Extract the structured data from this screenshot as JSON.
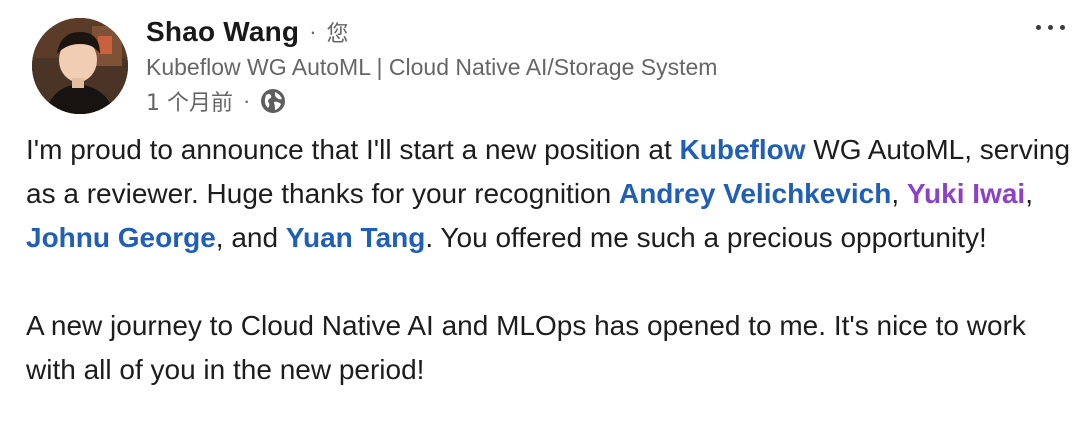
{
  "author": {
    "name": "Shao Wang",
    "separator": "·",
    "degree": "您",
    "headline": "Kubeflow WG AutoML | Cloud Native AI/Storage System"
  },
  "meta": {
    "timestamp": "1 个月前",
    "separator": "·",
    "visibility_icon": "globe-icon"
  },
  "menu_icon": "more-horizontal-icon",
  "post": {
    "p1": {
      "t1": "I'm proud to announce that I'll start a new position at ",
      "m1": "Kubeflow",
      "t2": " WG AutoML, serving as a reviewer. Huge thanks for your recognition ",
      "m2": "Andrey Velichkevich",
      "t3": ", ",
      "m3": "Yuki Iwai",
      "t4": ", ",
      "m4": "Johnu George",
      "t5": ", and ",
      "m5": "Yuan Tang",
      "t6": ". You offered me such a precious opportunity!"
    },
    "p2": "A new journey to Cloud Native AI and MLOps has opened to me. It's nice to work with all of you in the new period!"
  },
  "colors": {
    "mention_blue": "#1f5fb8",
    "mention_purple": "#8c42c8",
    "secondary_text": "#666666"
  }
}
